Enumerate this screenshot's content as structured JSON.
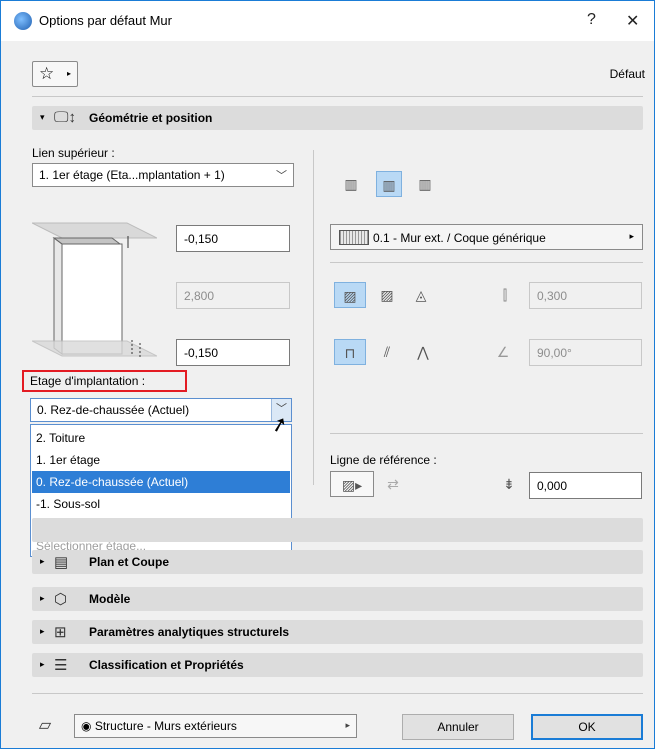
{
  "window": {
    "title": "Options par défaut Mur",
    "help": "?",
    "close": "✕"
  },
  "toolbar": {
    "favorites_icon": "☆",
    "favorites_arrow": "▸",
    "default_label": "Défaut"
  },
  "sections": {
    "geometry": {
      "label": "Géométrie et position",
      "icon": "🖵↕",
      "expanded": "▾"
    },
    "plan": {
      "label": "Plan et Coupe",
      "icon": "▤",
      "expanded": "▸"
    },
    "model": {
      "label": "Modèle",
      "icon": "⬡",
      "expanded": "▸"
    },
    "analytic": {
      "label": "Paramètres analytiques structurels",
      "icon": "⊞",
      "expanded": "▸"
    },
    "classification": {
      "label": "Classification et Propriétés",
      "icon": "☰",
      "expanded": "▸"
    }
  },
  "geometry": {
    "top_link_label": "Lien supérieur :",
    "top_link_value": "1. 1er étage (Eta...mplantation + 1)",
    "top_offset": "-0,150",
    "height": "2,800",
    "bottom_offset": "-0,150",
    "home_story_label": "Etage d'implantation :",
    "home_story_value": "0. Rez-de-chaussée (Actuel)",
    "composite": "0.1 - Mur ext. / Coque générique",
    "thickness": "0,300",
    "angle": "90,00°",
    "ref_line_label": "Ligne de référence :",
    "ref_offset": "0,000"
  },
  "story_options": [
    "2. Toiture",
    "1. 1er étage",
    "0. Rez-de-chaussée (Actuel)",
    "-1. Sous-sol"
  ],
  "story_selected_index": 2,
  "story_select_other": "Sélectionner étage...",
  "footer": {
    "layer": "Structure - Murs extérieurs",
    "cancel": "Annuler",
    "ok": "OK"
  },
  "colors": {
    "accent": "#2e7ed6",
    "highlight": "#e31b23",
    "selected_icon": "#b9d9f5"
  }
}
